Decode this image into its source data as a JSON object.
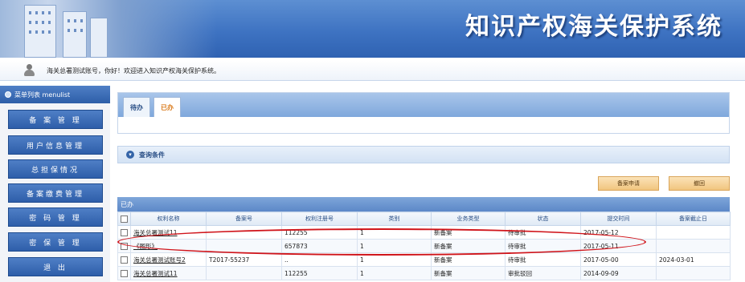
{
  "header": {
    "system_title": "知识产权海关保护系统"
  },
  "welcome": {
    "text": "海关总署测试账号，你好！欢迎进入知识产权海关保护系统。"
  },
  "sidebar": {
    "menu_title": "菜单列表 menulist",
    "items": [
      {
        "label": "备 案 管 理"
      },
      {
        "label": "用户信息管理"
      },
      {
        "label": "总担保情况"
      },
      {
        "label": "备案缴费管理"
      },
      {
        "label": "密 码 管 理"
      },
      {
        "label": "密 保 管 理"
      },
      {
        "label": "退    出"
      }
    ]
  },
  "tabs": [
    {
      "label": "待办",
      "active": false
    },
    {
      "label": "已办",
      "active": true
    }
  ],
  "query": {
    "label": "查询条件"
  },
  "buttons": {
    "apply": "备案申请",
    "withdraw": "撤回"
  },
  "grid": {
    "title": "已办",
    "columns": [
      "权利名称",
      "备案号",
      "权利注册号",
      "类别",
      "业务类型",
      "状态",
      "提交时间",
      "备案截止日"
    ],
    "rows": [
      {
        "name": "海关总署测试11",
        "record_no": "",
        "reg_no": "112255",
        "category": "1",
        "biz_type": "新备案",
        "status": "待审批",
        "submit_time": "2017-05-12",
        "deadline": ""
      },
      {
        "name": "《图形》",
        "record_no": "",
        "reg_no": "657873",
        "category": "1",
        "biz_type": "新备案",
        "status": "待审批",
        "submit_time": "2017-05-11",
        "deadline": ""
      },
      {
        "name": "海关总署测试账号2",
        "record_no": "T2017-55237",
        "reg_no": "..",
        "category": "1",
        "biz_type": "新备案",
        "status": "待审批",
        "submit_time": "2017-05-00",
        "deadline": "2024-03-01"
      },
      {
        "name": "海关总署测试11",
        "record_no": "",
        "reg_no": "112255",
        "category": "1",
        "biz_type": "新备案",
        "status": "审批驳回",
        "submit_time": "2014-09-09",
        "deadline": ""
      }
    ]
  },
  "colors": {
    "banner_blue": "#3e73c2",
    "menu_blue": "#2e5ea9",
    "highlight_red": "#d0141a",
    "button_orange": "#f1c57f"
  }
}
